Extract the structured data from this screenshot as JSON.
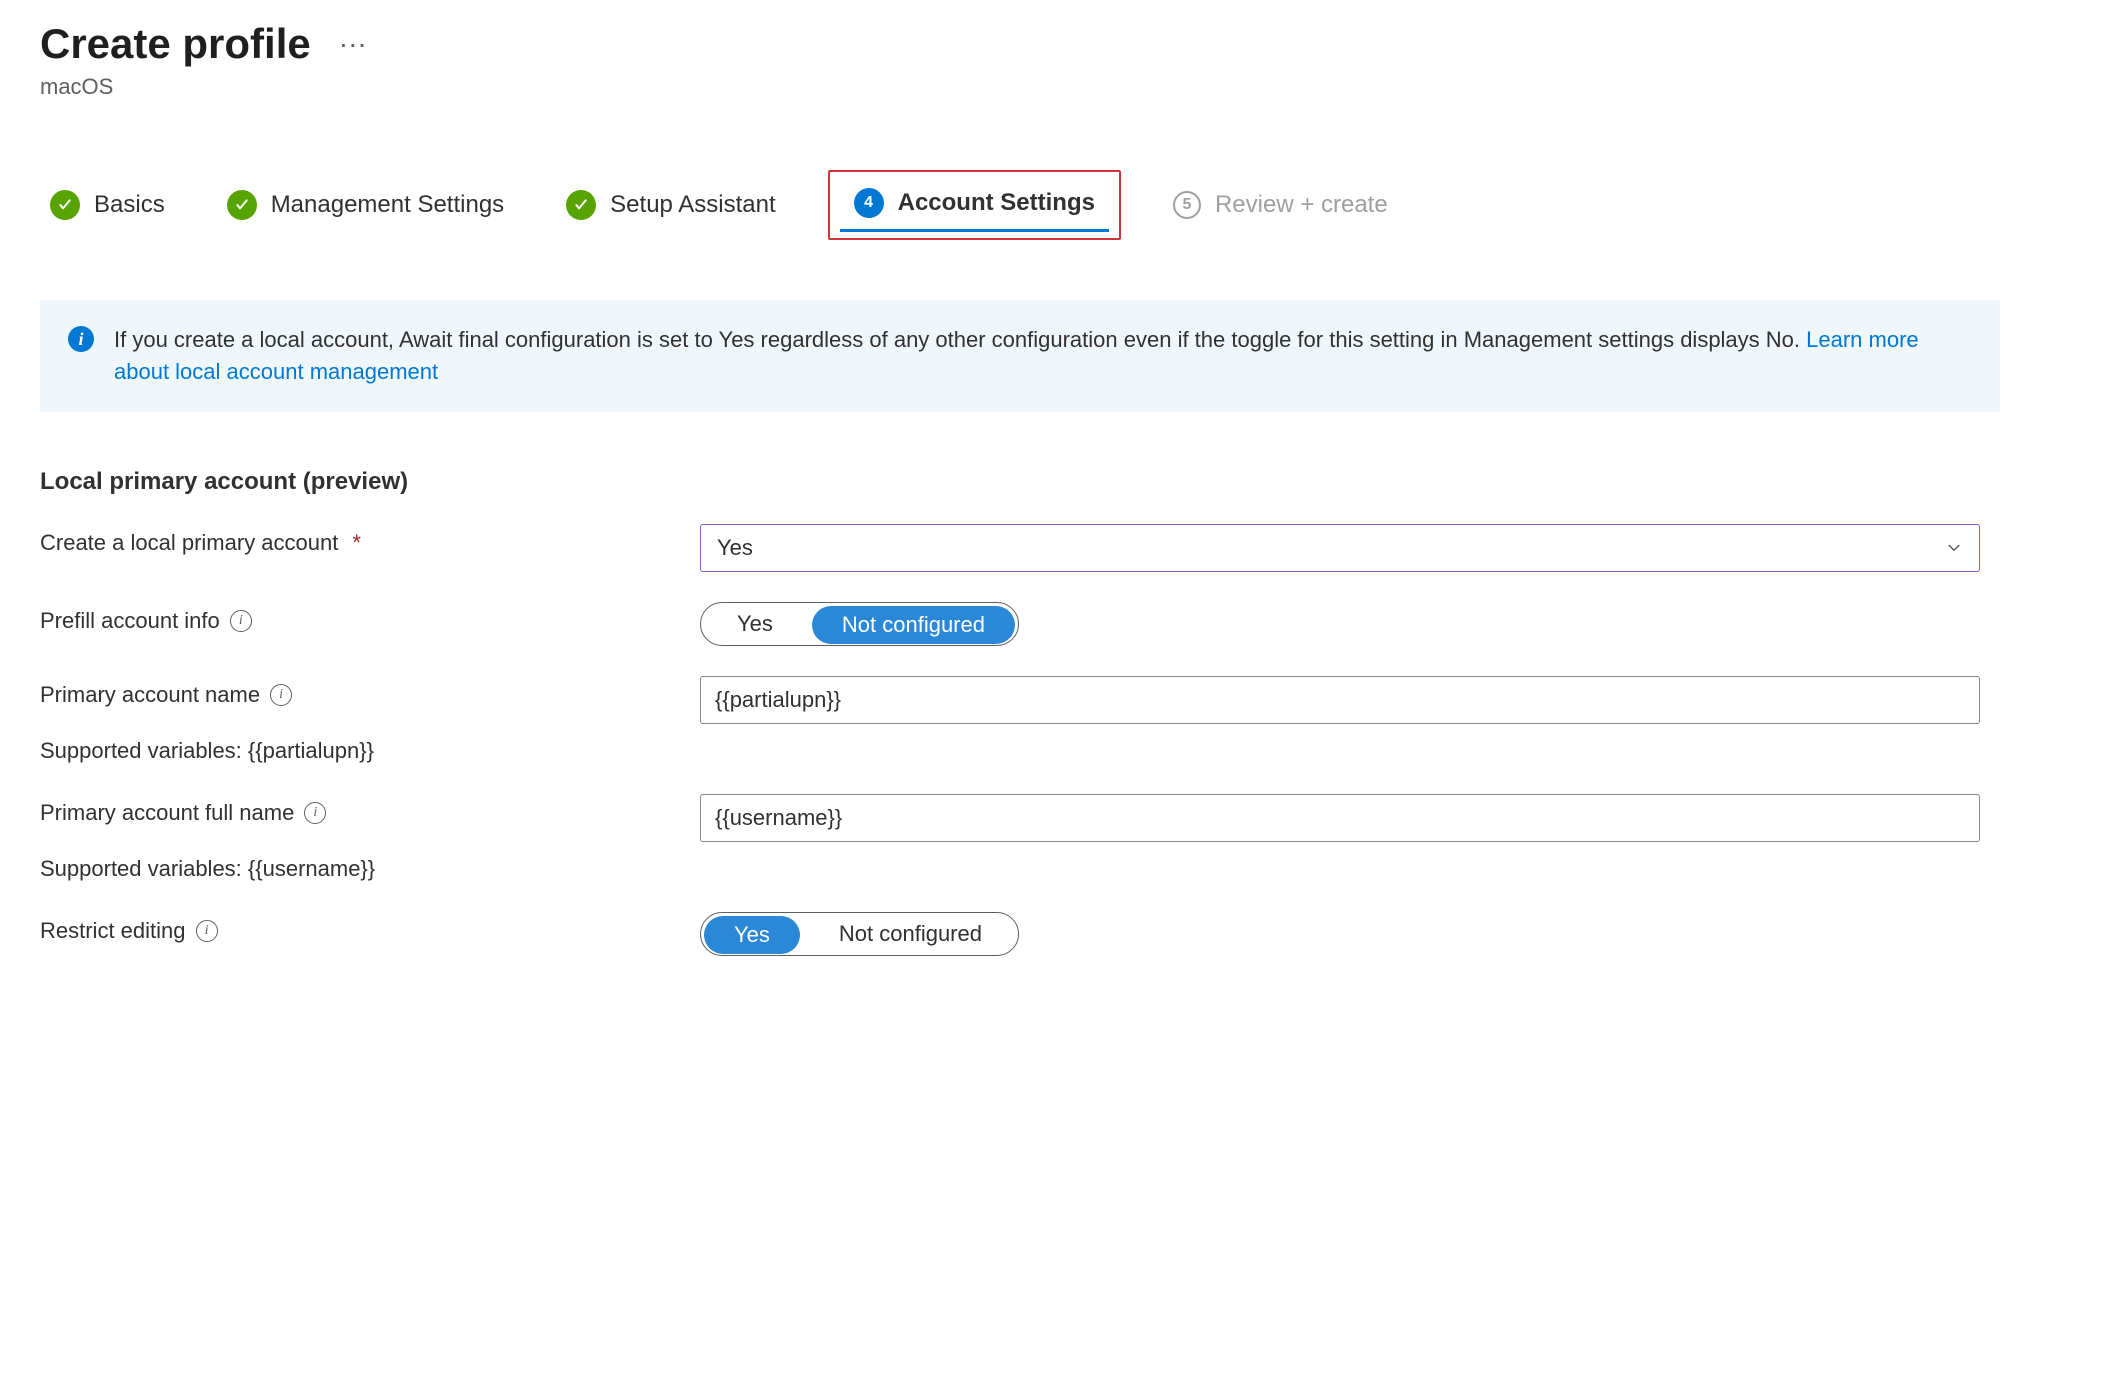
{
  "header": {
    "title": "Create profile",
    "subtitle": "macOS"
  },
  "steps": [
    {
      "label": "Basics",
      "state": "done"
    },
    {
      "label": "Management Settings",
      "state": "done"
    },
    {
      "label": "Setup Assistant",
      "state": "done"
    },
    {
      "label": "Account Settings",
      "state": "current",
      "number": "4"
    },
    {
      "label": "Review + create",
      "state": "future",
      "number": "5"
    }
  ],
  "infobox": {
    "text": "If you create a local account, Await final configuration is set to Yes regardless of any other configuration even if the toggle for this setting in Management settings displays No. ",
    "link_text": "Learn more about local account management"
  },
  "section_heading": "Local primary account (preview)",
  "fields": {
    "create_local": {
      "label": "Create a local primary account",
      "required": true,
      "value": "Yes"
    },
    "prefill": {
      "label": "Prefill account info",
      "options": [
        "Yes",
        "Not configured"
      ],
      "selected": "Not configured"
    },
    "account_name": {
      "label": "Primary account name",
      "value": "{{partialupn}}",
      "helper": "Supported variables: {{partialupn}}"
    },
    "full_name": {
      "label": "Primary account full name",
      "value": "{{username}}",
      "helper": "Supported variables: {{username}}"
    },
    "restrict": {
      "label": "Restrict editing",
      "options": [
        "Yes",
        "Not configured"
      ],
      "selected": "Yes"
    }
  }
}
